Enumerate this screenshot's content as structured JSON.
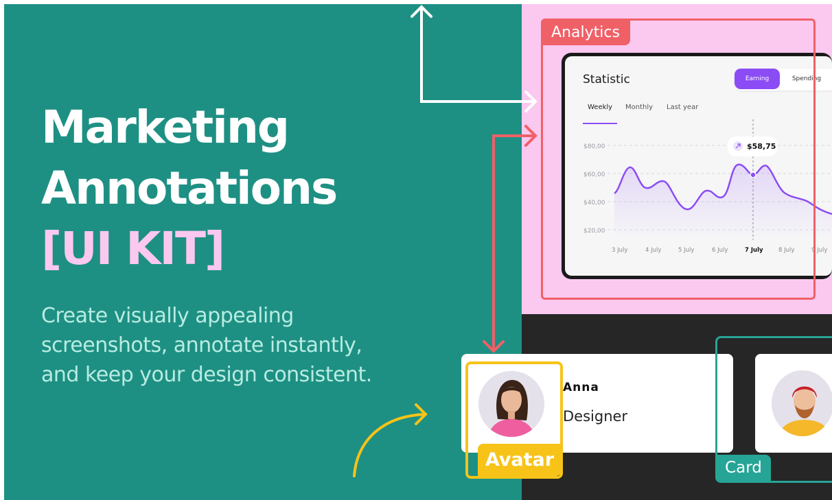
{
  "headline": {
    "line1": "Marketing",
    "line2": "Annotations",
    "line3": "[UI KIT]"
  },
  "subtitle": {
    "line1": "Create visually appealing",
    "line2": "screenshots, annotate instantly,",
    "line3": "and keep your design consistent."
  },
  "annotations": {
    "analytics": "Analytics",
    "avatar": "Avatar",
    "card": "Card"
  },
  "dashboard": {
    "title": "Statistic",
    "toggle": {
      "earning": "Earning",
      "spending": "Spending"
    },
    "period_tabs": [
      "Weekly",
      "Monthly",
      "Last year"
    ],
    "tooltip": "$58,75",
    "y_ticks": [
      "$80,00",
      "$60,00",
      "$40,00",
      "$20,00"
    ],
    "x_ticks": [
      "3 July",
      "4 July",
      "5 July",
      "6 July",
      "7 July",
      "8 July",
      "9 July"
    ],
    "highlighted_x": "7 July"
  },
  "profile": {
    "name": "Anna",
    "role": "Designer"
  },
  "colors": {
    "teal": "#1e9083",
    "pink": "#fbc8ef",
    "analytics_red": "#f06067",
    "avatar_yellow": "#f7c318",
    "card_teal": "#26a596",
    "chart_purple": "#8b4cf5"
  }
}
